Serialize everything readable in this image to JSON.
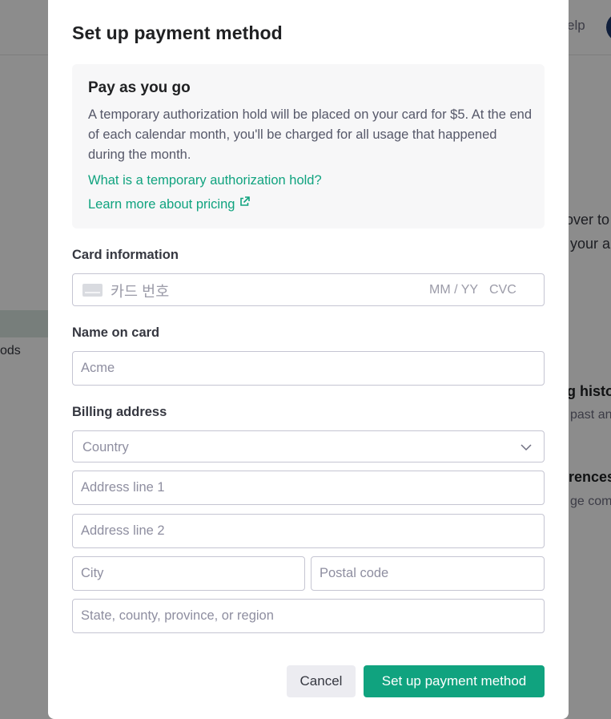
{
  "background": {
    "help_text": "elp",
    "sidebar_text": "ods",
    "text_lines": [
      "over to",
      "your a",
      "g histo",
      "past and",
      "rences",
      "ge com"
    ]
  },
  "modal": {
    "title": "Set up payment method",
    "info": {
      "title": "Pay as you go",
      "body": "A temporary authorization hold will be placed on your card for $5. At the end of each calendar month, you'll be charged for all usage that happened during the month.",
      "link_hold": "What is a temporary authorization hold?",
      "link_pricing": "Learn more about pricing"
    },
    "card": {
      "label": "Card information",
      "number_placeholder": "카드 번호",
      "expiry_placeholder": "MM / YY",
      "cvc_placeholder": "CVC"
    },
    "name": {
      "label": "Name on card",
      "placeholder": "Acme"
    },
    "billing": {
      "label": "Billing address",
      "country_placeholder": "Country",
      "address1_placeholder": "Address line 1",
      "address2_placeholder": "Address line 2",
      "city_placeholder": "City",
      "postal_placeholder": "Postal code",
      "state_placeholder": "State, county, province, or region"
    },
    "buttons": {
      "cancel": "Cancel",
      "submit": "Set up payment method"
    }
  },
  "colors": {
    "accent": "#10a37f",
    "overlay": "rgba(0,0,0,0.45)"
  },
  "icons": [
    "credit-card-icon",
    "external-link-icon",
    "chevron-down-icon"
  ]
}
